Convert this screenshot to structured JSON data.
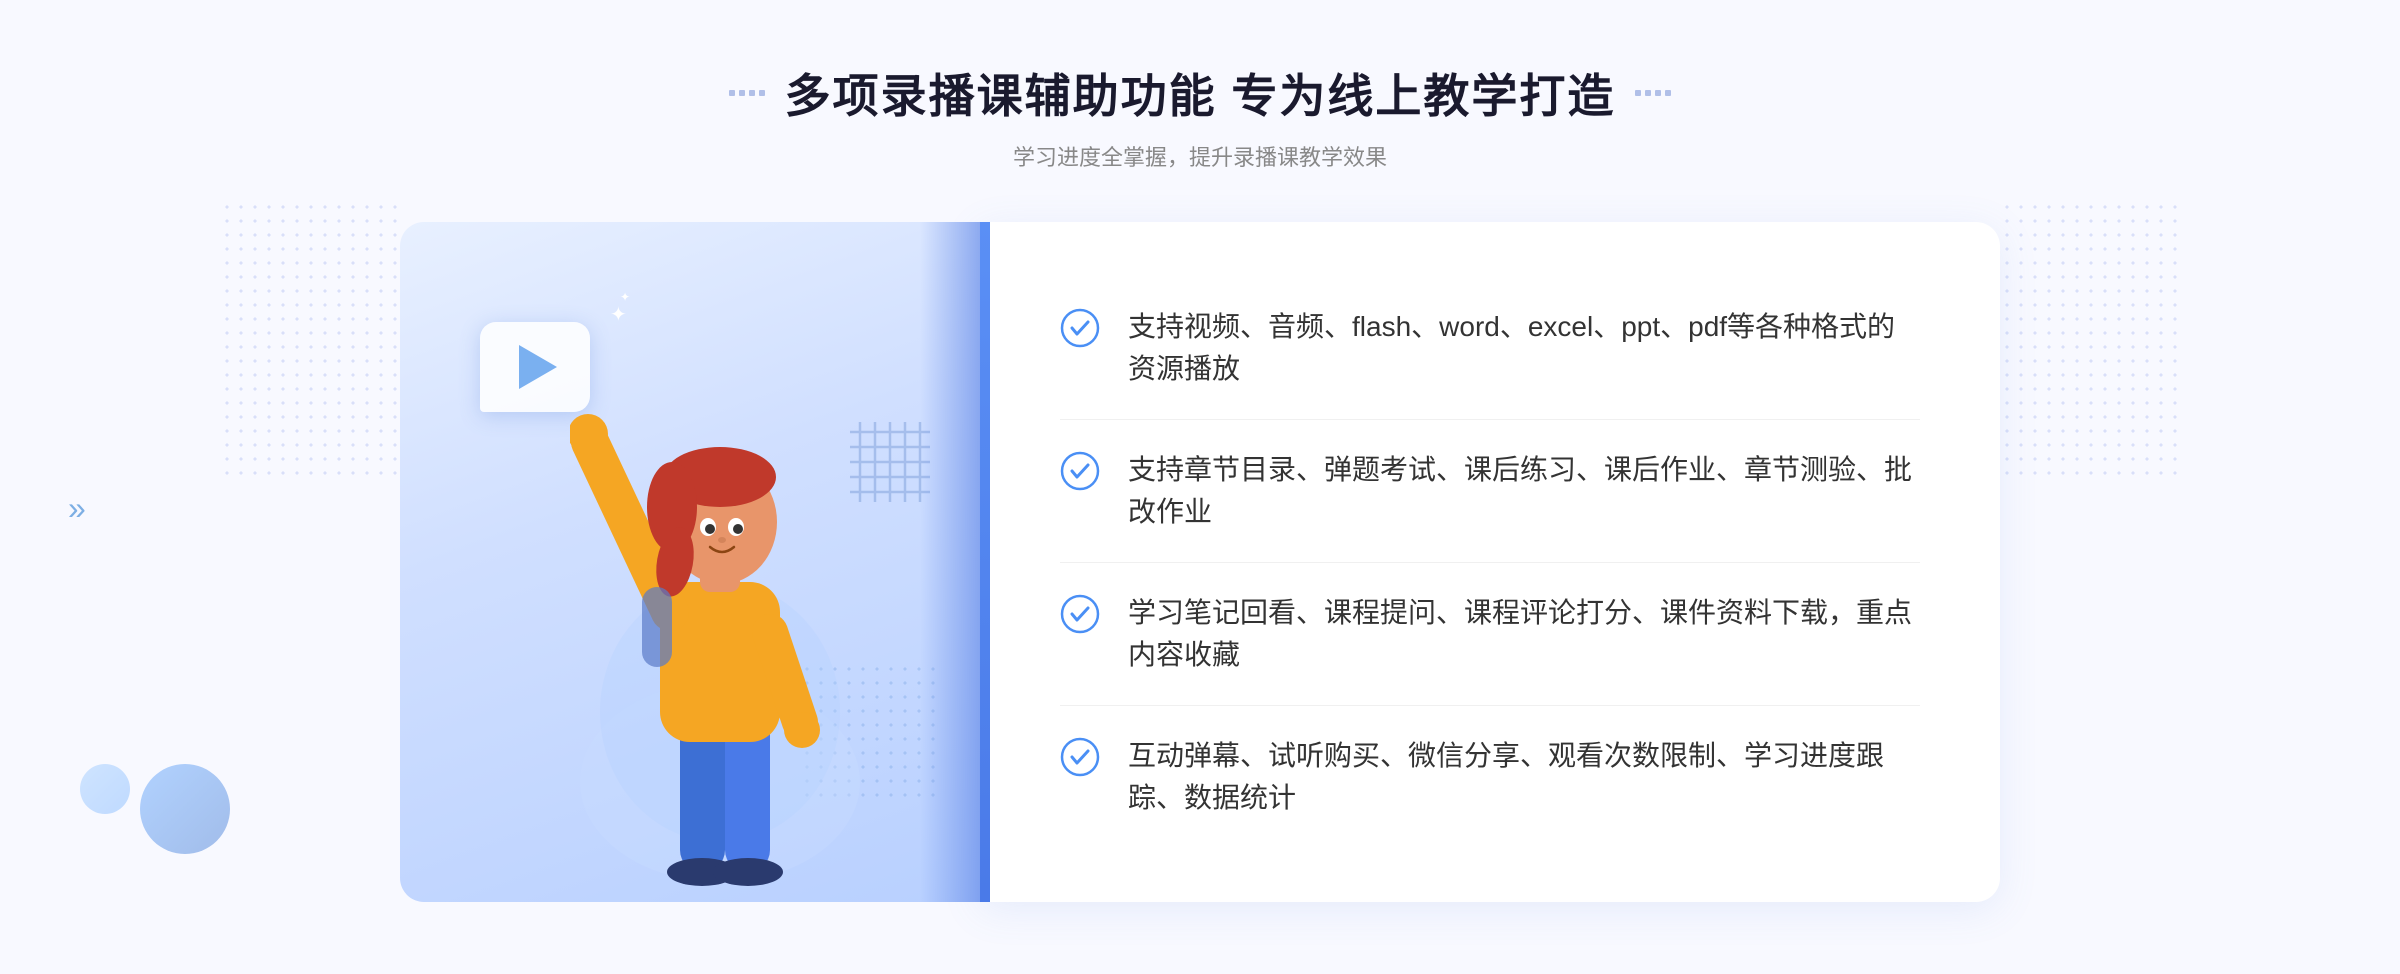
{
  "page": {
    "background_color": "#f5f7ff"
  },
  "header": {
    "title": "多项录播课辅助功能 专为线上教学打造",
    "subtitle": "学习进度全掌握，提升录播课教学效果",
    "decorator_left": "⁚⁚",
    "decorator_right": "⁚⁚"
  },
  "features": [
    {
      "id": 1,
      "text": "支持视频、音频、flash、word、excel、ppt、pdf等各种格式的资源播放"
    },
    {
      "id": 2,
      "text": "支持章节目录、弹题考试、课后练习、课后作业、章节测验、批改作业"
    },
    {
      "id": 3,
      "text": "学习笔记回看、课程提问、课程评论打分、课件资料下载，重点内容收藏"
    },
    {
      "id": 4,
      "text": "互动弹幕、试听购买、微信分享、观看次数限制、学习进度跟踪、数据统计"
    }
  ],
  "icons": {
    "check": "check-circle-icon",
    "play": "play-icon",
    "arrow_left": "»",
    "arrow_right": "«"
  },
  "colors": {
    "accent": "#4a7ae8",
    "text_primary": "#333333",
    "text_secondary": "#888888",
    "title": "#1a1a2e",
    "check_color": "#4a8ff5",
    "bg": "#f5f7ff"
  }
}
